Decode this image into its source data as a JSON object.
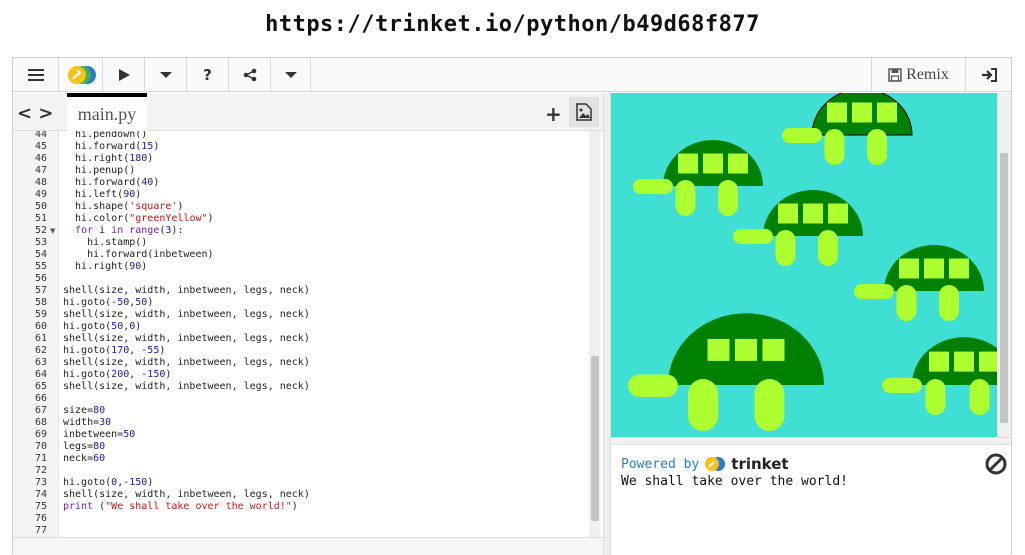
{
  "page": {
    "url": "https://trinket.io/python/b49d68f877"
  },
  "toolbar": {
    "menu_icon": "hamburger-icon",
    "logo_icon": "trinket-logo-icon",
    "run_icon": "play-icon",
    "run_menu_icon": "chevron-down-icon",
    "help_label": "?",
    "share_icon": "share-icon",
    "share_menu_icon": "chevron-down-icon",
    "remix_label": "Remix",
    "login_icon": "sign-in-icon"
  },
  "editor": {
    "nav_label": "< >",
    "tab_label": "main.py",
    "add_file_label": "+",
    "lines": [
      {
        "n": "44",
        "tokens": [
          [
            "  hi.pendown()",
            ""
          ]
        ]
      },
      {
        "n": "45",
        "tokens": [
          [
            "  hi.forward(",
            ""
          ],
          [
            "15",
            "num"
          ],
          [
            ")",
            ""
          ]
        ]
      },
      {
        "n": "46",
        "tokens": [
          [
            "  hi.right(",
            ""
          ],
          [
            "180",
            "num"
          ],
          [
            ")",
            ""
          ]
        ]
      },
      {
        "n": "47",
        "tokens": [
          [
            "  hi.penup()",
            ""
          ]
        ]
      },
      {
        "n": "48",
        "tokens": [
          [
            "  hi.forward(",
            ""
          ],
          [
            "40",
            "num"
          ],
          [
            ")",
            ""
          ]
        ]
      },
      {
        "n": "49",
        "tokens": [
          [
            "  hi.left(",
            ""
          ],
          [
            "90",
            "num"
          ],
          [
            ")",
            ""
          ]
        ]
      },
      {
        "n": "50",
        "tokens": [
          [
            "  hi.shape(",
            ""
          ],
          [
            "'square'",
            "str"
          ],
          [
            ")",
            ""
          ]
        ]
      },
      {
        "n": "51",
        "tokens": [
          [
            "  hi.color(",
            ""
          ],
          [
            "\"greenYellow\"",
            "str"
          ],
          [
            ")",
            ""
          ]
        ]
      },
      {
        "n": "52",
        "fold": true,
        "tokens": [
          [
            "  ",
            ""
          ],
          [
            "for",
            "kw"
          ],
          [
            " i ",
            ""
          ],
          [
            "in",
            "kw"
          ],
          [
            " ",
            ""
          ],
          [
            "range",
            "kw"
          ],
          [
            "(",
            ""
          ],
          [
            "3",
            "num"
          ],
          [
            "):",
            ""
          ]
        ]
      },
      {
        "n": "53",
        "tokens": [
          [
            "    hi.stamp()",
            ""
          ]
        ]
      },
      {
        "n": "54",
        "tokens": [
          [
            "    hi.forward(inbetween)",
            ""
          ]
        ]
      },
      {
        "n": "55",
        "tokens": [
          [
            "  hi.right(",
            ""
          ],
          [
            "90",
            "num"
          ],
          [
            ")",
            ""
          ]
        ]
      },
      {
        "n": "56",
        "tokens": [
          [
            "",
            ""
          ]
        ]
      },
      {
        "n": "57",
        "tokens": [
          [
            "shell(size, width, inbetween, legs, neck)",
            ""
          ]
        ]
      },
      {
        "n": "58",
        "tokens": [
          [
            "hi.goto(",
            ""
          ],
          [
            "-50",
            "num"
          ],
          [
            ",",
            ""
          ],
          [
            "50",
            "num"
          ],
          [
            ")",
            ""
          ]
        ]
      },
      {
        "n": "59",
        "tokens": [
          [
            "shell(size, width, inbetween, legs, neck)",
            ""
          ]
        ]
      },
      {
        "n": "60",
        "tokens": [
          [
            "hi.goto(",
            ""
          ],
          [
            "50",
            "num"
          ],
          [
            ",",
            ""
          ],
          [
            "0",
            "num"
          ],
          [
            ")",
            ""
          ]
        ]
      },
      {
        "n": "61",
        "tokens": [
          [
            "shell(size, width, inbetween, legs, neck)",
            ""
          ]
        ]
      },
      {
        "n": "62",
        "tokens": [
          [
            "hi.goto(",
            ""
          ],
          [
            "170",
            "num"
          ],
          [
            ", ",
            ""
          ],
          [
            "-55",
            "num"
          ],
          [
            ")",
            ""
          ]
        ]
      },
      {
        "n": "63",
        "tokens": [
          [
            "shell(size, width, inbetween, legs, neck)",
            ""
          ]
        ]
      },
      {
        "n": "64",
        "tokens": [
          [
            "hi.goto(",
            ""
          ],
          [
            "200",
            "num"
          ],
          [
            ", ",
            ""
          ],
          [
            "-150",
            "num"
          ],
          [
            ")",
            ""
          ]
        ]
      },
      {
        "n": "65",
        "tokens": [
          [
            "shell(size, width, inbetween, legs, neck)",
            ""
          ]
        ]
      },
      {
        "n": "66",
        "tokens": [
          [
            "",
            ""
          ]
        ]
      },
      {
        "n": "67",
        "tokens": [
          [
            "size=",
            ""
          ],
          [
            "80",
            "num"
          ]
        ]
      },
      {
        "n": "68",
        "tokens": [
          [
            "width=",
            ""
          ],
          [
            "30",
            "num"
          ]
        ]
      },
      {
        "n": "69",
        "tokens": [
          [
            "inbetween=",
            ""
          ],
          [
            "50",
            "num"
          ]
        ]
      },
      {
        "n": "70",
        "tokens": [
          [
            "legs=",
            ""
          ],
          [
            "80",
            "num"
          ]
        ]
      },
      {
        "n": "71",
        "tokens": [
          [
            "neck=",
            ""
          ],
          [
            "60",
            "num"
          ]
        ]
      },
      {
        "n": "72",
        "tokens": [
          [
            "",
            ""
          ]
        ]
      },
      {
        "n": "73",
        "tokens": [
          [
            "hi.goto(",
            ""
          ],
          [
            "0",
            "num"
          ],
          [
            ",",
            ""
          ],
          [
            "-150",
            "num"
          ],
          [
            ")",
            ""
          ]
        ]
      },
      {
        "n": "74",
        "tokens": [
          [
            "shell(size, width, inbetween, legs, neck)",
            ""
          ]
        ]
      },
      {
        "n": "75",
        "tokens": [
          [
            "print",
            "kw"
          ],
          [
            " (",
            ""
          ],
          [
            "\"We shall take over the world!\"",
            "str"
          ],
          [
            ")",
            ""
          ]
        ]
      },
      {
        "n": "76",
        "tokens": [
          [
            "",
            ""
          ]
        ]
      },
      {
        "n": "77",
        "tokens": [
          [
            "",
            ""
          ]
        ]
      }
    ]
  },
  "output": {
    "canvas_background": "#3fdfd3",
    "shell_color": "#008000",
    "limb_color": "#adff2f",
    "powered_by": "Powered by",
    "brand": "trinket",
    "console_text": "We shall take over the world!",
    "stop_icon": "stop-icon"
  }
}
